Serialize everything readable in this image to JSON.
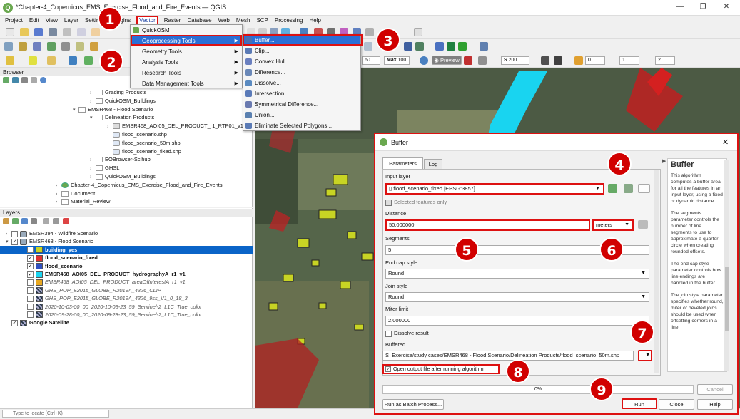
{
  "window": {
    "title": "*Chapter-4_Copernicus_EMS_Exercise_Flood_and_Fire_Events — QGIS"
  },
  "menubar": [
    "Project",
    "Edit",
    "View",
    "Layer",
    "Settings",
    "Plugins",
    "Vector",
    "Raster",
    "Database",
    "Web",
    "Mesh",
    "SCP",
    "Processing",
    "Help"
  ],
  "toolbar": {
    "preview_label": "Preview",
    "fields": [
      "60",
      "Max",
      "100",
      "S",
      "200",
      "0",
      "1",
      "2"
    ]
  },
  "vector_menu": {
    "items": [
      {
        "label": "QuickOSM",
        "submenu": false
      },
      {
        "label": "Geoprocessing Tools",
        "submenu": true
      },
      {
        "label": "Geometry Tools",
        "submenu": true
      },
      {
        "label": "Analysis Tools",
        "submenu": true
      },
      {
        "label": "Research Tools",
        "submenu": true
      },
      {
        "label": "Data Management Tools",
        "submenu": true
      }
    ]
  },
  "geoprocessing_menu": {
    "items": [
      "Buffer...",
      "Clip...",
      "Convex Hull...",
      "Difference...",
      "Dissolve...",
      "Intersection...",
      "Symmetrical Difference...",
      "Union...",
      "Eliminate Selected Polygons..."
    ]
  },
  "browser": {
    "title": "Browser",
    "items": [
      {
        "label": "Grading Products",
        "level": 4,
        "type": "folder",
        "expanded": false
      },
      {
        "label": "QuickOSM_Buildings",
        "level": 4,
        "type": "folder",
        "expanded": false
      },
      {
        "label": "EMSR468 - Flood Scenario",
        "level": 3,
        "type": "folder",
        "expanded": true
      },
      {
        "label": "Delineation Products",
        "level": 4,
        "type": "folder",
        "expanded": true
      },
      {
        "label": "EMSR468_AOI05_DEL_PRODUCT_r1_RTP01_v1_vector.zip",
        "level": 5,
        "type": "zip",
        "expanded": false
      },
      {
        "label": "flood_scenario.shp",
        "level": 5,
        "type": "shp",
        "expanded": false
      },
      {
        "label": "flood_scenario_50m.shp",
        "level": 5,
        "type": "shp",
        "expanded": false
      },
      {
        "label": "flood_scenario_fixed.shp",
        "level": 5,
        "type": "shp",
        "expanded": false
      },
      {
        "label": "EOBrowser-Scihub",
        "level": 4,
        "type": "folder",
        "expanded": false
      },
      {
        "label": "GHSL",
        "level": 4,
        "type": "folder",
        "expanded": false
      },
      {
        "label": "QuickOSM_Buildings",
        "level": 4,
        "type": "folder",
        "expanded": false
      },
      {
        "label": "Chapter-4_Copernicus_EMS_Exercise_Flood_and_Fire_Events",
        "level": 2,
        "type": "project",
        "expanded": false
      },
      {
        "label": "Document",
        "level": 2,
        "type": "folder",
        "expanded": false
      },
      {
        "label": "Material_Review",
        "level": 2,
        "type": "folder",
        "expanded": false
      }
    ]
  },
  "layers": {
    "title": "Layers",
    "items": [
      {
        "label": "EMSR394 - Wildfire Scenario",
        "level": 0,
        "group": true,
        "checked": false,
        "color": "",
        "style": "normal",
        "selected": false
      },
      {
        "label": "EMSR468 - Flood Scenario",
        "level": 0,
        "group": true,
        "checked": true,
        "color": "",
        "style": "normal",
        "selected": false
      },
      {
        "label": "building_yes",
        "level": 1,
        "group": false,
        "checked": true,
        "color": "#c8d424",
        "style": "bold",
        "selected": true
      },
      {
        "label": "flood_scenario_fixed",
        "level": 1,
        "group": false,
        "checked": true,
        "color": "#e03030",
        "style": "bold",
        "selected": false
      },
      {
        "label": "flood_scenario",
        "level": 1,
        "group": false,
        "checked": true,
        "color": "#3050c0",
        "style": "bold",
        "selected": false
      },
      {
        "label": "EMSR468_AOI05_DEL_PRODUCT_hydrographyA_r1_v1",
        "level": 1,
        "group": false,
        "checked": true,
        "color": "#19d4f0",
        "style": "bold",
        "selected": false
      },
      {
        "label": "EMSR468_AOI05_DEL_PRODUCT_areaOfInterestA_r1_v1",
        "level": 1,
        "group": false,
        "checked": false,
        "color": "#e8a820",
        "style": "italic",
        "selected": false
      },
      {
        "label": "GHS_POP_E2015_GLOBE_R2019A_4326_CLIP",
        "level": 1,
        "group": false,
        "checked": false,
        "color": "raster",
        "style": "italic",
        "selected": false
      },
      {
        "label": "GHS_POP_E2015_GLOBE_R2019A_4326_9ss_V1_0_18_3",
        "level": 1,
        "group": false,
        "checked": false,
        "color": "raster",
        "style": "italic",
        "selected": false
      },
      {
        "label": "2020-10-03-00_00_2020-10-03-23_59_Sentinel-2_L1C_True_color",
        "level": 1,
        "group": false,
        "checked": false,
        "color": "raster",
        "style": "italic",
        "selected": false
      },
      {
        "label": "2020-09-28-00_00_2020-09-28-23_59_Sentinel-2_L1C_True_color",
        "level": 1,
        "group": false,
        "checked": false,
        "color": "raster",
        "style": "italic",
        "selected": false
      },
      {
        "label": "Google Satellite",
        "level": 0,
        "group": false,
        "checked": true,
        "color": "raster",
        "style": "bold",
        "selected": false
      }
    ]
  },
  "statusbar": {
    "locate_placeholder": "Type to locate (Ctrl+K)"
  },
  "dialog": {
    "title": "Buffer",
    "tabs": [
      "Parameters",
      "Log"
    ],
    "input_layer_label": "Input layer",
    "input_layer_value": "flood_scenario_fixed [EPSG:3857]",
    "selected_features_label": "Selected features only",
    "distance_label": "Distance",
    "distance_value": "50,000000",
    "distance_unit": "meters",
    "segments_label": "Segments",
    "segments_value": "5",
    "end_cap_label": "End cap style",
    "end_cap_value": "Round",
    "join_style_label": "Join style",
    "join_style_value": "Round",
    "miter_label": "Miter limit",
    "miter_value": "2,000000",
    "dissolve_label": "Dissolve result",
    "buffered_label": "Buffered",
    "buffered_value": "S_Exercise/study cases/EMSR468 - Flood Scenario/Delineation Products/flood_scenario_50m.shp",
    "open_output_label": "Open output file after running algorithm",
    "progress": 0,
    "progress_text": "0%",
    "buttons": {
      "cancel": "Cancel",
      "batch": "Run as Batch Process...",
      "run": "Run",
      "close": "Close",
      "help": "Help"
    },
    "help_title": "Buffer",
    "help_paragraphs": [
      "This algorithm computes a buffer area for all the features in an input layer, using a fixed or dynamic distance.",
      "The segments parameter controls the number of line segments to use to approximate a quarter circle when creating rounded offsets.",
      "The end cap style parameter controls how line endings are handled in the buffer.",
      "The join style parameter specifies whether round, miter or beveled joins should be used when offsetting corners in a line."
    ]
  },
  "callouts": [
    "1",
    "2",
    "3",
    "4",
    "5",
    "6",
    "7",
    "8",
    "9"
  ]
}
